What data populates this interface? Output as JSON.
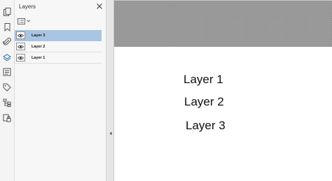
{
  "panel": {
    "title": "Layers"
  },
  "toolbar": {
    "tools": [
      "pages-icon",
      "bookmark-icon",
      "attachment-icon",
      "layers-icon",
      "content-icon",
      "tag-icon",
      "model-tree-icon",
      "security-icon"
    ],
    "active": "layers-icon"
  },
  "layers": [
    {
      "label": "Layer 3",
      "selected": true
    },
    {
      "label": "Layer 2",
      "selected": false
    },
    {
      "label": "Layer 1",
      "selected": false
    }
  ],
  "document": {
    "lines": [
      "Layer 1",
      "Layer 2",
      "Layer 3"
    ]
  },
  "colors": {
    "selection": "#a8c5e4",
    "page_band": "#9a9a9a"
  }
}
